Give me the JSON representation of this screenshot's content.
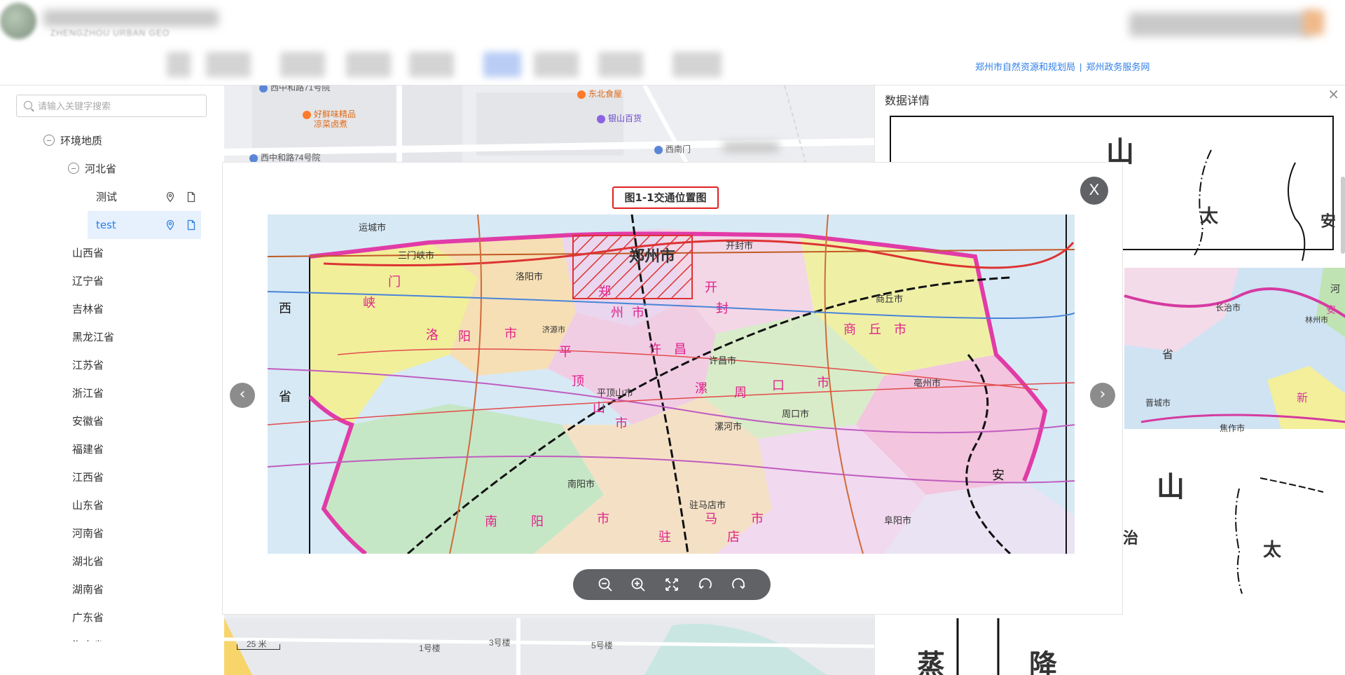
{
  "header": {
    "logo_sub": "ZHENGZHOU URBAN GEO",
    "ext_links": [
      "郑州市自然资源和规划局",
      "郑州政务服务网"
    ],
    "link_separator": "|"
  },
  "sidebar": {
    "search_placeholder": "请输入关键字搜索",
    "tree": {
      "root": "环境地质",
      "child": "河北省",
      "leaves": [
        "测试",
        "test"
      ],
      "provinces": [
        "山西省",
        "辽宁省",
        "吉林省",
        "黑龙江省",
        "江苏省",
        "浙江省",
        "安徽省",
        "福建省",
        "江西省",
        "山东省",
        "河南省",
        "湖北省",
        "湖南省",
        "广东省",
        "海南省"
      ]
    }
  },
  "map": {
    "pois": [
      "西中和路71号院",
      "东北食屋",
      "好鲜味精品",
      "凉菜卤煮",
      "银山百货",
      "西南门",
      "西中和路74号院",
      "1号楼",
      "3号楼",
      "5号楼"
    ],
    "scale_label": "25 米"
  },
  "detail": {
    "title": "数据详情",
    "close": "×",
    "doc_chars": [
      "山",
      "太",
      "安",
      "山",
      "治",
      "太",
      "蒸",
      "降"
    ],
    "map_labels": [
      "长治市",
      "省",
      "晋城市",
      "焦作市",
      "新",
      "林州市",
      "安",
      "河"
    ]
  },
  "modal": {
    "title": "图1-1交通位置图",
    "close": "X",
    "prev": "‹",
    "next": "›",
    "tools": [
      "zoom-out",
      "zoom-in",
      "fit-screen",
      "rotate-left",
      "rotate-right"
    ],
    "map": {
      "cities": [
        "运城市",
        "三门峡市",
        "洛阳市",
        "郑州市",
        "开封市",
        "商丘市",
        "许昌市",
        "漯河市",
        "平顶山市",
        "周口市",
        "南阳市",
        "驻马店市",
        "阜阳市",
        "亳州市",
        "济源市"
      ],
      "regions": [
        "门",
        "峡",
        "洛",
        "阳",
        "市",
        "郑",
        "州",
        "市",
        "开",
        "封",
        "商",
        "丘",
        "市",
        "许",
        "昌",
        "平",
        "顶",
        "山",
        "市",
        "漯",
        "周",
        "口",
        "市",
        "南",
        "阳",
        "市",
        "驻",
        "马",
        "店",
        "市",
        "西",
        "省",
        "安"
      ]
    }
  },
  "colors": {
    "accent": "#2f7ee8",
    "highlight_border": "#e02020",
    "toolbar_bg": "#606266"
  }
}
